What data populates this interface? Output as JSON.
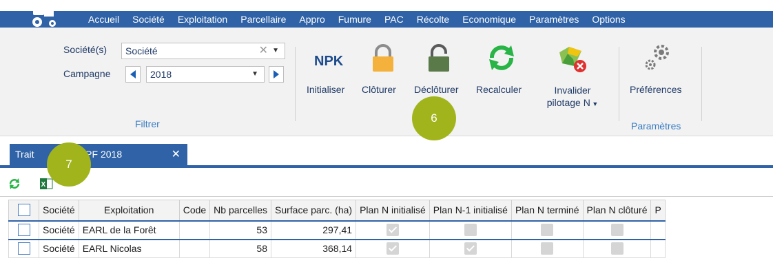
{
  "menu": {
    "items": [
      "Accueil",
      "Société",
      "Exploitation",
      "Parcellaire",
      "Appro",
      "Fumure",
      "PAC",
      "Récolte",
      "Economique",
      "Paramètres",
      "Options"
    ]
  },
  "filters": {
    "societe_label": "Société(s)",
    "societe_value": "Société",
    "campagne_label": "Campagne",
    "campagne_value": "2018",
    "group_label": "Filtrer"
  },
  "ribbon": {
    "npk_text": "NPK",
    "initialiser": "Initialiser",
    "cloturer": "Clôturer",
    "decloturer": "Déclôturer",
    "recalculer": "Recalculer",
    "invalider_line1": "Invalider",
    "invalider_line2": "pilotage N",
    "preferences": "Préférences",
    "params_group_label": "Paramètres"
  },
  "badges": {
    "b6": "6",
    "b7": "7"
  },
  "tab": {
    "label": "Trait          des PPF 2018"
  },
  "grid": {
    "columns": [
      "Société",
      "Exploitation",
      "Code",
      "Nb parcelles",
      "Surface parc. (ha)",
      "Plan N initialisé",
      "Plan N-1 initialisé",
      "Plan N terminé",
      "Plan N clôturé",
      "P"
    ],
    "rows": [
      {
        "societe": "Société",
        "exploitation": "EARL de la Forêt",
        "code": "",
        "nb": "53",
        "surface": "297,41",
        "plan_n_init": true,
        "plan_n1_init": false,
        "plan_n_term": false,
        "plan_n_clot": false
      },
      {
        "societe": "Société",
        "exploitation": "EARL Nicolas",
        "code": "",
        "nb": "58",
        "surface": "368,14",
        "plan_n_init": true,
        "plan_n1_init": true,
        "plan_n_term": false,
        "plan_n_clot": false
      }
    ]
  },
  "colors": {
    "menu_blue": "#2f62a6",
    "badge_green": "#a2b41b"
  },
  "icons": [
    "tractor-logo-icon",
    "padlock-closed-icon",
    "padlock-open-icon",
    "recalculate-icon",
    "map-invalid-icon",
    "gears-icon",
    "refresh-icon",
    "excel-icon"
  ]
}
